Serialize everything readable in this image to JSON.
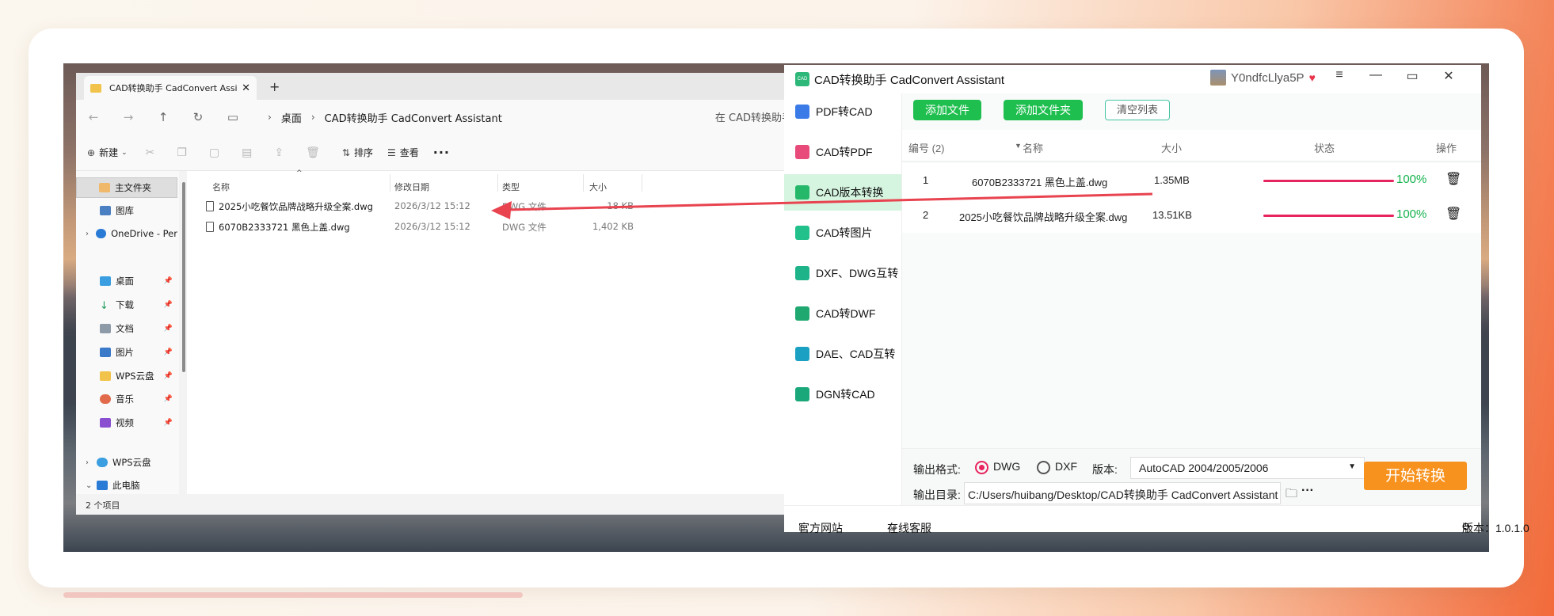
{
  "explorer": {
    "tab_title": "CAD转换助手 CadConvert Assi",
    "tab_close": "✕",
    "new_tab": "+",
    "breadcrumb": [
      "桌面",
      "CAD转换助手 CadConvert Assistant"
    ],
    "search_hint": "在 CAD转换助手",
    "toolbar": {
      "new": "新建",
      "sort": "排序",
      "view": "查看",
      "more": "···"
    },
    "sidebar": [
      {
        "label": "主文件夹",
        "active": true
      },
      {
        "label": "图库"
      },
      {
        "label": "OneDrive - Per"
      },
      {
        "label": "桌面"
      },
      {
        "label": "下载"
      },
      {
        "label": "文档"
      },
      {
        "label": "图片"
      },
      {
        "label": "WPS云盘"
      },
      {
        "label": "音乐"
      },
      {
        "label": "视频"
      },
      {
        "label": "WPS云盘"
      },
      {
        "label": "此电脑"
      }
    ],
    "columns": {
      "name": "名称",
      "date": "修改日期",
      "type": "类型",
      "size": "大小"
    },
    "files": [
      {
        "name": "2025小吃餐饮品牌战略升级全案.dwg",
        "date": "2026/3/12 15:12",
        "type": "DWG 文件",
        "size": "18 KB"
      },
      {
        "name": "6070B2333721 黑色上盖.dwg",
        "date": "2026/3/12 15:12",
        "type": "DWG 文件",
        "size": "1,402 KB"
      }
    ],
    "status": "2 个项目"
  },
  "cad": {
    "title": "CAD转换助手 CadConvert Assistant",
    "logo_text": "CAD",
    "user": "Y0ndfcLlya5P",
    "window_buttons": [
      "≡",
      "—",
      "▭",
      "✕"
    ],
    "sidebar": [
      {
        "label": "PDF转CAD",
        "color": "#3a7be8"
      },
      {
        "label": "CAD转PDF",
        "color": "#e84a7a"
      },
      {
        "label": "CAD版本转换",
        "color": "#25b86a",
        "active": true
      },
      {
        "label": "CAD转图片",
        "color": "#22c08a"
      },
      {
        "label": "DXF、DWG互转",
        "color": "#1fb38a"
      },
      {
        "label": "CAD转DWF",
        "color": "#1fa86f"
      },
      {
        "label": "DAE、CAD互转",
        "color": "#1aa0c2"
      },
      {
        "label": "DGN转CAD",
        "color": "#1aa87a"
      }
    ],
    "buttons": {
      "add_file": "添加文件",
      "add_folder": "添加文件夹",
      "clear": "清空列表"
    },
    "table_head": {
      "no": "编号 (2)",
      "name": "名称",
      "size": "大小",
      "status": "状态",
      "op": "操作"
    },
    "rows": [
      {
        "no": "1",
        "name": "6070B2333721 黑色上盖.dwg",
        "size": "1.35MB",
        "progress": 100,
        "pct": "100%"
      },
      {
        "no": "2",
        "name": "2025小吃餐饮品牌战略升级全案.dwg",
        "size": "13.51KB",
        "progress": 100,
        "pct": "100%"
      }
    ],
    "options": {
      "format_label": "输出格式:",
      "dwg": "DWG",
      "dxf": "DXF",
      "version_label": "版本:",
      "version_value": "AutoCAD 2004/2005/2006",
      "dir_label": "输出目录:",
      "dir_value": "C:/Users/huibang/Desktop/CAD转换助手 CadConvert Assistant",
      "more": "···"
    },
    "start_button": "开始转换",
    "footer": {
      "website": "官方网站",
      "support": "在线客服",
      "version": "版本：1.0.1.0"
    },
    "colors": {
      "green": "#1fbf4f",
      "progress": "#e8245f",
      "orange": "#f7921e",
      "arrow": "#e8434f"
    }
  }
}
